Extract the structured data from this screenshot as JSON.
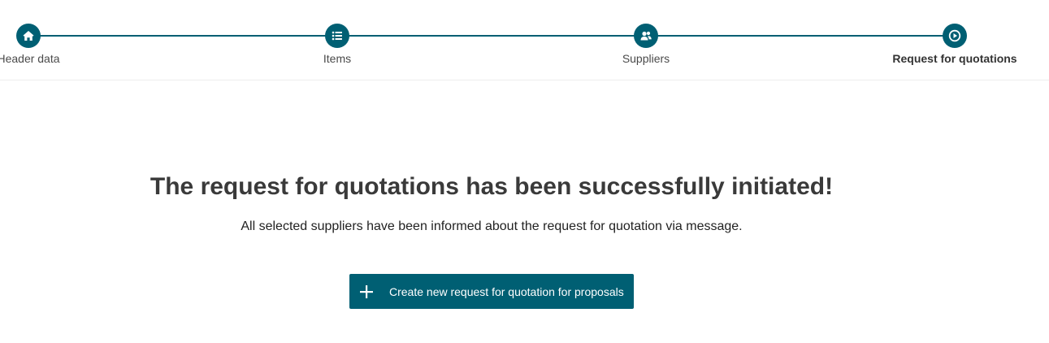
{
  "stepper": {
    "steps": [
      {
        "label": "Header data",
        "icon": "home-icon",
        "active": false
      },
      {
        "label": "Items",
        "icon": "list-icon",
        "active": false
      },
      {
        "label": "Suppliers",
        "icon": "users-icon",
        "active": false
      },
      {
        "label": "Request for quotations",
        "icon": "play-icon",
        "active": true
      }
    ],
    "color": "#005f73"
  },
  "main": {
    "title": "The request for quotations has been successfully initiated!",
    "message": "All selected suppliers have been informed about the request for quotation via message.",
    "create_button": {
      "label": "Create new request for quotation for proposals",
      "icon": "plus-icon",
      "color": "#005f73"
    }
  }
}
